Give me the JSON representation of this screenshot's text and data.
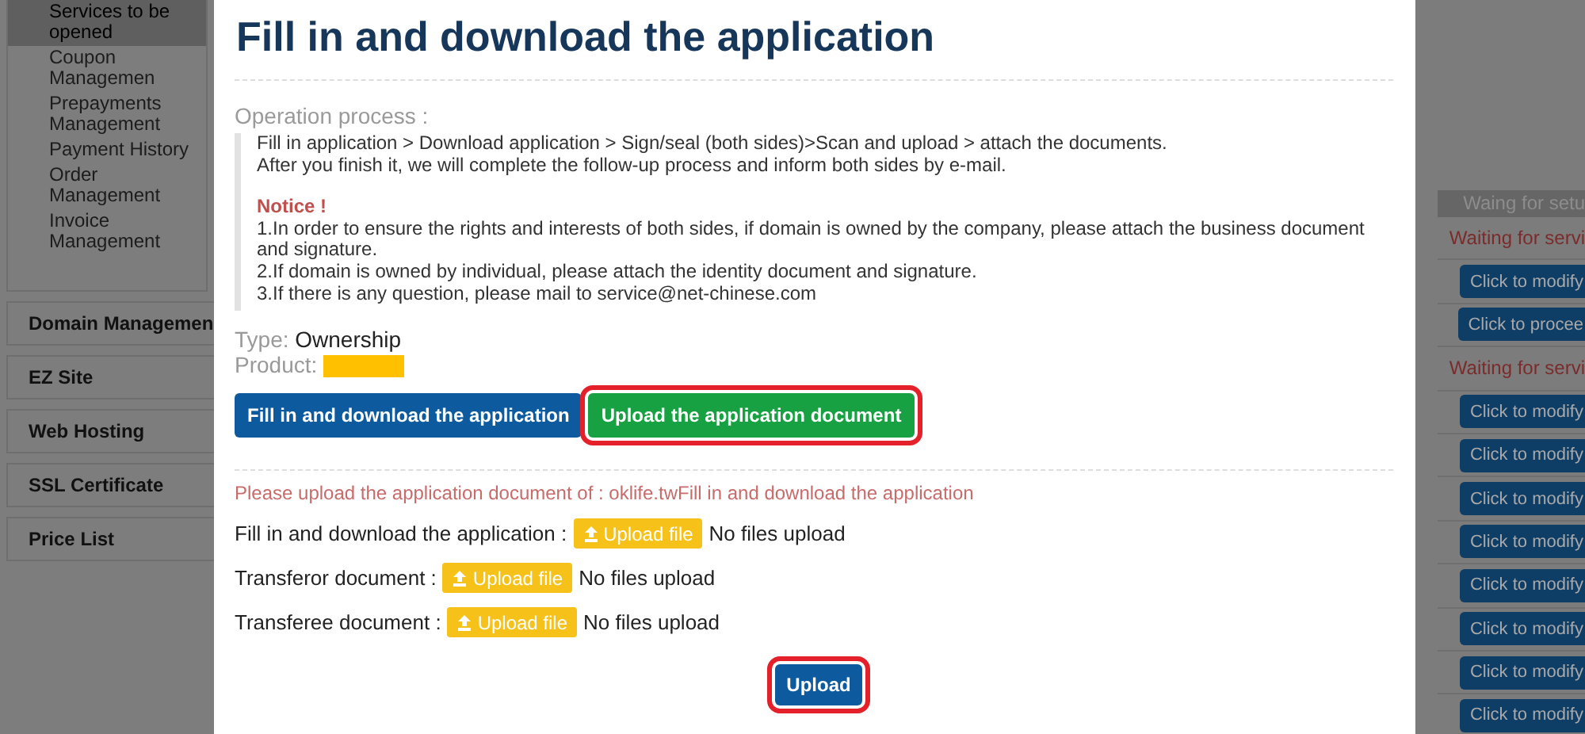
{
  "sidebar": {
    "sub_items": [
      {
        "label": "Services to be opened",
        "selected": true
      },
      {
        "label": "Coupon Managemen",
        "selected": false
      },
      {
        "label": "Prepayments Management",
        "selected": false
      },
      {
        "label": "Payment History",
        "selected": false
      },
      {
        "label": "Order Management",
        "selected": false
      },
      {
        "label": "Invoice Management",
        "selected": false
      }
    ],
    "sections": [
      "Domain Managemen",
      "EZ Site",
      "Web Hosting",
      "SSL Certificate",
      "Price List"
    ]
  },
  "dialog": {
    "title": "Fill in and download the application",
    "process_label": "Operation process :",
    "process_lines": [
      "Fill in application > Download application > Sign/seal (both sides)>Scan and upload > attach the documents.",
      "After you finish it, we will complete the follow-up process and inform both sides by e-mail."
    ],
    "notice_title": "Notice !",
    "notice_lines": [
      "1.In order to ensure the rights and interests of both sides, if domain is owned by the company, please attach the business document and signature.",
      "2.If domain is owned by individual, please attach the identity document and signature.",
      "3.If there is any question, please mail to service@net-chinese.com"
    ],
    "type_label": "Type:",
    "type_value": "Ownership",
    "product_label": "Product:",
    "actions": [
      {
        "label": "Fill in and download the application",
        "kind": "primary",
        "highlighted": false
      },
      {
        "label": "Upload the application document",
        "kind": "success",
        "highlighted": true
      }
    ],
    "upload_hint": "Please upload the application document of : oklife.twFill in and download the application",
    "uploads": [
      {
        "label": "Fill in and download the application :",
        "button": "Upload file",
        "status": "No files upload"
      },
      {
        "label": "Transferor document :",
        "button": "Upload file",
        "status": "No files upload"
      },
      {
        "label": "Transferee document :",
        "button": "Upload file",
        "status": "No files upload"
      }
    ],
    "submit": {
      "label": "Upload",
      "highlighted": true
    }
  },
  "status_column": {
    "header": "Waing for setu",
    "rows": [
      {
        "kind": "text",
        "label": "Waiting for servi"
      },
      {
        "kind": "button",
        "label": "Click to modify"
      },
      {
        "kind": "button",
        "label": "Click to procee"
      },
      {
        "kind": "text",
        "label": "Waiting for servi"
      },
      {
        "kind": "button",
        "label": "Click to modify"
      },
      {
        "kind": "button",
        "label": "Click to modify"
      },
      {
        "kind": "button",
        "label": "Click to modify"
      },
      {
        "kind": "button",
        "label": "Click to modify"
      },
      {
        "kind": "button",
        "label": "Click to modify"
      },
      {
        "kind": "button",
        "label": "Click to modify"
      },
      {
        "kind": "button",
        "label": "Click to modify"
      },
      {
        "kind": "button",
        "label": "Click to modify"
      }
    ]
  }
}
